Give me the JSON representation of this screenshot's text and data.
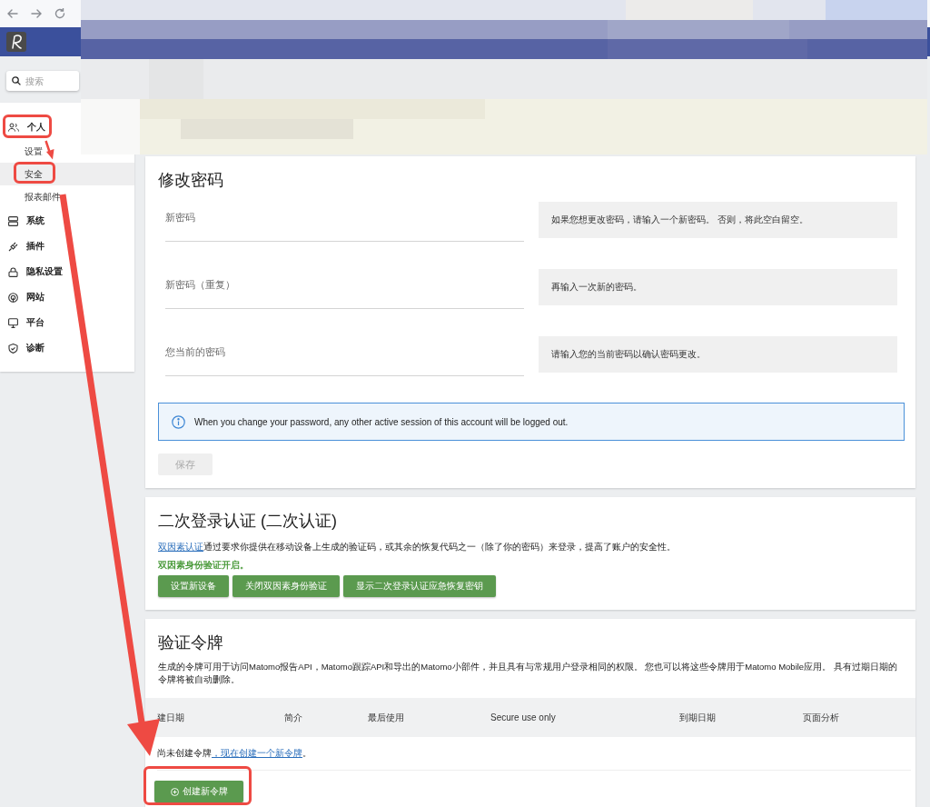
{
  "search": {
    "placeholder": "搜索"
  },
  "sidebar": {
    "items": [
      {
        "label": "个人",
        "children": [
          {
            "label": "设置",
            "selected": false
          },
          {
            "label": "安全",
            "selected": true
          },
          {
            "label": "报表邮件",
            "selected": false
          }
        ]
      },
      {
        "label": "系统"
      },
      {
        "label": "插件"
      },
      {
        "label": "隐私设置"
      },
      {
        "label": "网站"
      },
      {
        "label": "平台"
      },
      {
        "label": "诊断"
      }
    ]
  },
  "password": {
    "title": "修改密码",
    "fields": [
      {
        "placeholder": "新密码",
        "help": "如果您想更改密码，请输入一个新密码。 否则，将此空白留空。"
      },
      {
        "placeholder": "新密码（重复）",
        "help": "再输入一次新的密码。"
      },
      {
        "placeholder": "您当前的密码",
        "help": "请输入您的当前密码以确认密码更改。"
      }
    ],
    "notice": "When you change your password, any other active session of this account will be logged out.",
    "save_button": {
      "label": "保存",
      "disabled": true
    }
  },
  "two_factor": {
    "title": "二次登录认证 (二次认证)",
    "description": {
      "link": "双因素认证",
      "text": "通过要求你提供在移动设备上生成的验证码，或其余的恢复代码之一（除了你的密码）来登录，提高了账户的安全性。"
    },
    "status": "双因素身份验证开启。",
    "buttons": [
      "设置新设备",
      "关闭双因素身份验证",
      "显示二次登录认证应急恢复密钥"
    ]
  },
  "tokens": {
    "title": "验证令牌",
    "description": "生成的令牌可用于访问Matomo报告API，Matomo跟踪API和导出的Matomo小部件，并且具有与常规用户登录相同的权限。 您也可以将这些令牌用于Matomo Mobile应用。 具有过期日期的令牌将被自动删除。",
    "columns": [
      "建日期",
      "简介",
      "最后使用",
      "Secure use only",
      "到期日期",
      "页面分析"
    ],
    "empty": {
      "text": "尚未创建令牌",
      "link": "，现在创建一个新令牌",
      "end": "。"
    },
    "create_button": "创建新令牌"
  }
}
